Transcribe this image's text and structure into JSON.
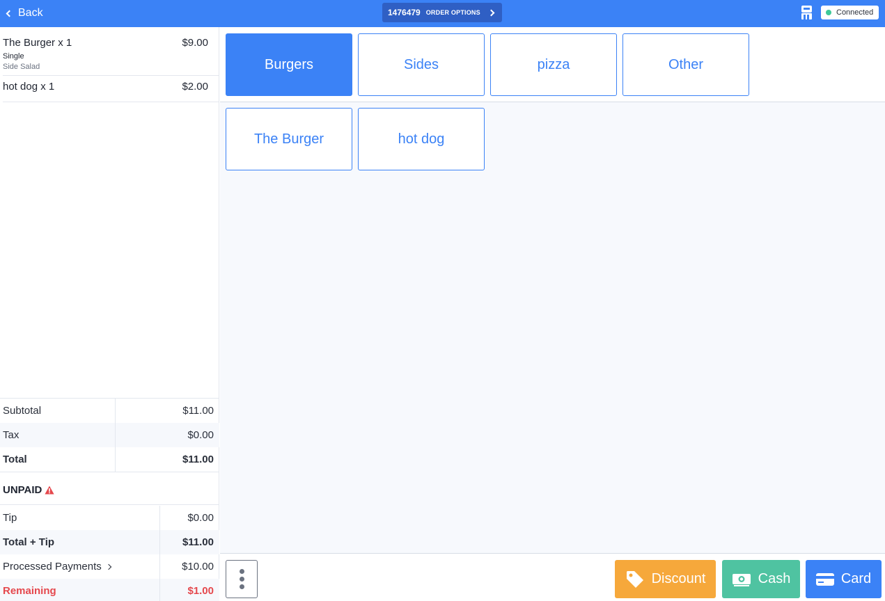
{
  "header": {
    "back_label": "Back",
    "order_number": "1476479",
    "order_options_label": "ORDER OPTIONS",
    "connection_status": "Connected"
  },
  "order": {
    "items": [
      {
        "name": "The Burger x 1",
        "price": "$9.00",
        "modifiers": [
          "Single",
          "Side Salad"
        ]
      },
      {
        "name": "hot dog x 1",
        "price": "$2.00",
        "modifiers": []
      }
    ]
  },
  "totals": {
    "subtotal_label": "Subtotal",
    "subtotal": "$11.00",
    "tax_label": "Tax",
    "tax": "$0.00",
    "total_label": "Total",
    "total": "$11.00"
  },
  "payment": {
    "status": "UNPAID",
    "tip_label": "Tip",
    "tip": "$0.00",
    "total_tip_label": "Total + Tip",
    "total_tip": "$11.00",
    "processed_label": "Processed Payments",
    "processed": "$10.00",
    "remaining_label": "Remaining",
    "remaining": "$1.00"
  },
  "categories": [
    {
      "label": "Burgers",
      "active": true
    },
    {
      "label": "Sides",
      "active": false
    },
    {
      "label": "pizza",
      "active": false
    },
    {
      "label": "Other",
      "active": false
    }
  ],
  "products": [
    {
      "label": "The Burger"
    },
    {
      "label": "hot dog"
    }
  ],
  "actions": {
    "discount_label": "Discount",
    "cash_label": "Cash",
    "card_label": "Card"
  },
  "colors": {
    "primary": "#3b82f6",
    "discount": "#f6a83b",
    "cash": "#4fc3a1",
    "danger": "#e5484d",
    "connected": "#3ec99a"
  }
}
